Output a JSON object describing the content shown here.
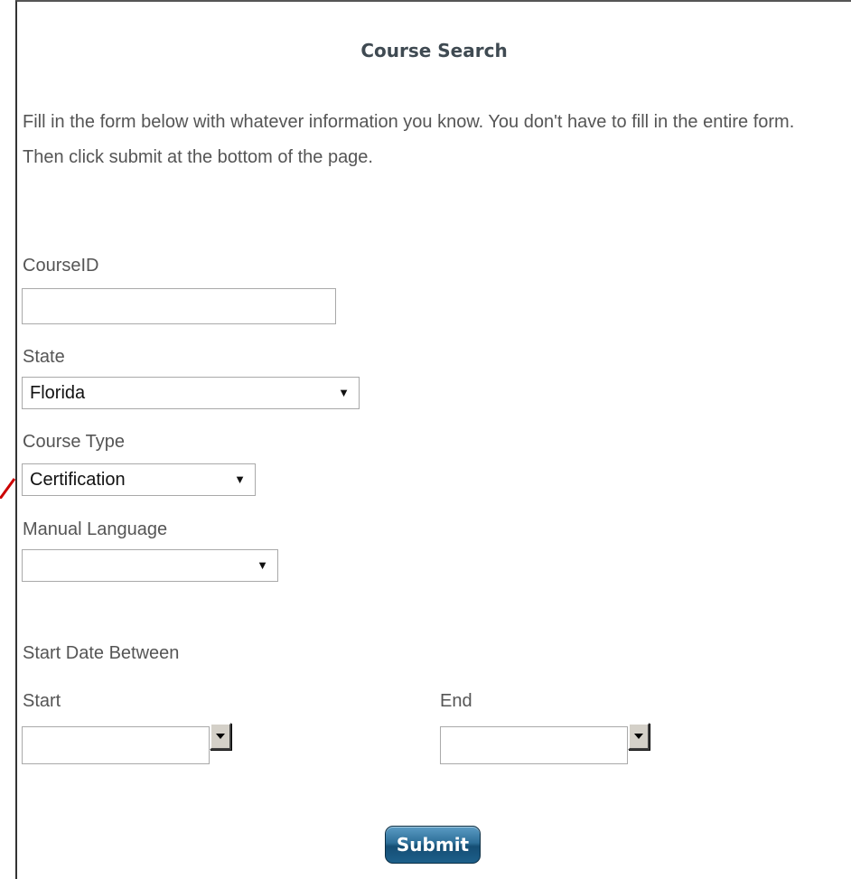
{
  "page": {
    "title": "Course Search",
    "intro": "Fill in the form below with whatever information you know. You don't have to fill in the entire form. Then click submit at the bottom of the page."
  },
  "form": {
    "course_id": {
      "label": "CourseID",
      "value": ""
    },
    "state": {
      "label": "State",
      "value": "Florida"
    },
    "course_type": {
      "label": "Course Type",
      "value": "Certification"
    },
    "manual_language": {
      "label": "Manual Language",
      "value": ""
    },
    "date_range": {
      "label": "Start Date Between",
      "start": {
        "label": "Start",
        "value": ""
      },
      "end": {
        "label": "End",
        "value": ""
      }
    },
    "submit_label": "Submit"
  },
  "colors": {
    "annotation_arrow": "#cc0000",
    "submit_button": "#1d5f8a"
  }
}
